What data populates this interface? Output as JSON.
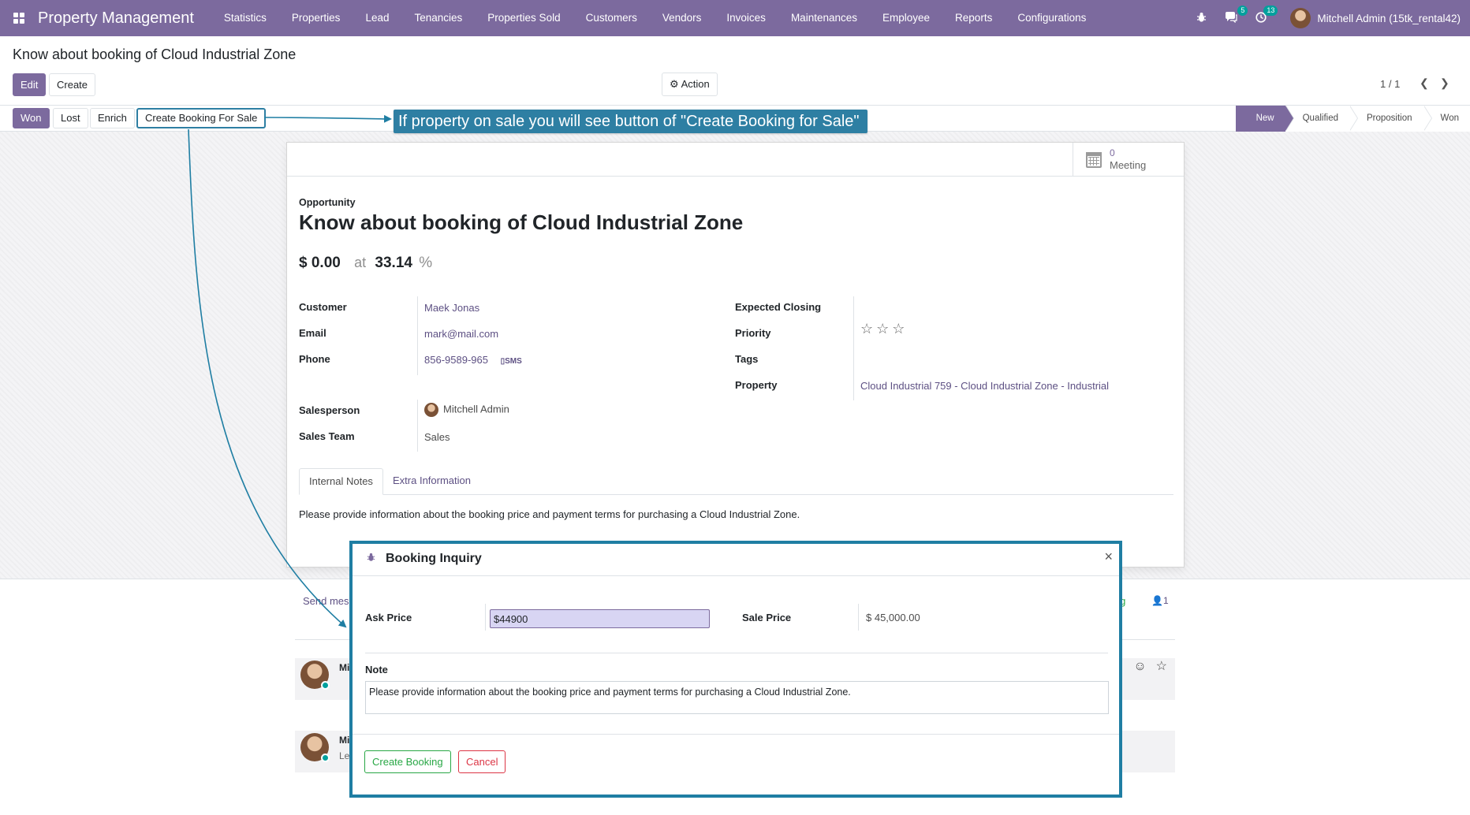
{
  "navbar": {
    "app_name": "Property Management",
    "menu": [
      "Statistics",
      "Properties",
      "Lead",
      "Tenancies",
      "Properties Sold",
      "Customers",
      "Vendors",
      "Invoices",
      "Maintenances",
      "Employee",
      "Reports",
      "Configurations"
    ],
    "messages_badge": "5",
    "activities_badge": "13",
    "user": "Mitchell Admin (15tk_rental42)",
    "icons": {
      "apps": "apps-grid-icon",
      "bug": "bug-icon",
      "messages": "chat-icon",
      "activities": "clock-icon"
    }
  },
  "control_panel": {
    "title": "Know about booking of Cloud Industrial Zone",
    "edit_label": "Edit",
    "create_label": "Create",
    "action_label": "Action",
    "action_icon": "gear-icon",
    "pager": "1 / 1"
  },
  "statusbar": {
    "buttons": [
      "Won",
      "Lost",
      "Enrich",
      "Create Booking For Sale"
    ],
    "stages": [
      "New",
      "Qualified",
      "Proposition",
      "Won"
    ],
    "active_stage": "New"
  },
  "callout": {
    "text": "If property on sale you will see button of \"Create Booking for Sale\""
  },
  "form": {
    "meeting_count": "0",
    "meeting_label": "Meeting",
    "type_label": "Opportunity",
    "name": "Know about booking of Cloud Industrial Zone",
    "expected_revenue": "$ 0.00",
    "at_label": "at",
    "probability": "33.14",
    "percent_sign": "%",
    "left_fields": {
      "customer_label": "Customer",
      "customer": "Maek Jonas",
      "email_label": "Email",
      "email": "mark@mail.com",
      "phone_label": "Phone",
      "phone": "856-9589-965",
      "sms_label": "SMS",
      "salesperson_label": "Salesperson",
      "salesperson": "Mitchell Admin",
      "sales_team_label": "Sales Team",
      "sales_team": "Sales"
    },
    "right_fields": {
      "expected_closing_label": "Expected Closing",
      "expected_closing": "",
      "priority_label": "Priority",
      "priority_stars": 0,
      "priority_max": 3,
      "tags_label": "Tags",
      "tags": "",
      "property_label": "Property",
      "property": "Cloud Industrial 759 - Cloud Industrial Zone - Industrial"
    },
    "tabs": [
      "Internal Notes",
      "Extra Information"
    ],
    "active_tab": "Internal Notes",
    "notes": "Please provide information about the booking price and payment terms for purchasing a Cloud Industrial Zone."
  },
  "chatter": {
    "send_message_label": "Send mes",
    "following_label": "ing",
    "followers_count": "1",
    "messages": [
      {
        "author": "Mi",
        "body": ""
      },
      {
        "author": "Mi",
        "body": "Le"
      }
    ]
  },
  "dialog": {
    "title": "Booking Inquiry",
    "ask_price_label": "Ask Price",
    "ask_price_value": "$44900",
    "sale_price_label": "Sale Price",
    "sale_price_value": "$ 45,000.00",
    "note_label": "Note",
    "note_value": "Please provide information about the booking price and payment terms for purchasing a Cloud Industrial Zone.",
    "create_booking_label": "Create Booking",
    "cancel_label": "Cancel",
    "close_symbol": "×"
  },
  "colors": {
    "brand": "#7c6a9e",
    "callout": "#2e7fa3",
    "badge": "#00a09d",
    "success": "#28a745",
    "danger": "#dc3545"
  }
}
